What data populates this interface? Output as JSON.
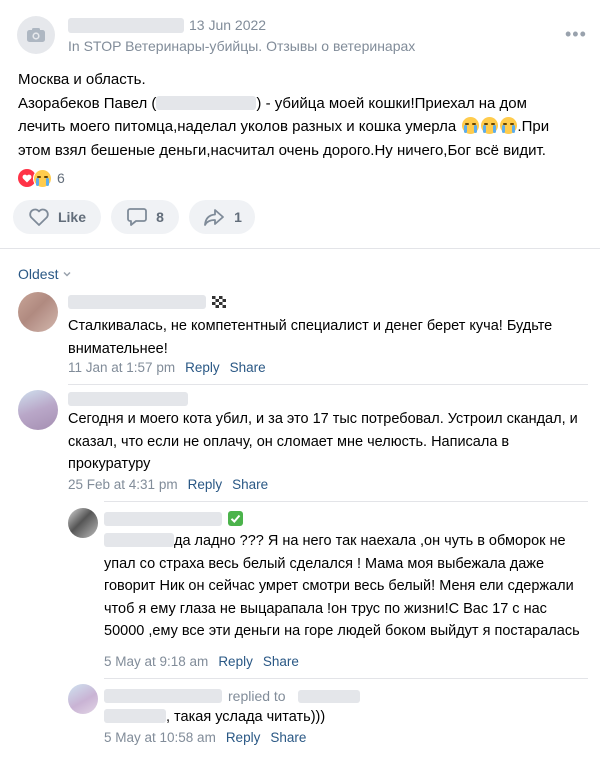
{
  "post": {
    "date": "13 Jun 2022",
    "group_prefix": "In",
    "group_name": "STOP Ветеринары-убийцы. Отзывы о ветеринарах",
    "text_line1": "Москва и область.",
    "text_name": "Азорабеков Павел",
    "text_after_name": ") - убийца моей кошки!Приехал на дом",
    "text_line3": "лечить моего питомца,наделал уколов разных и кошка умерла",
    "text_line3_end": ".При",
    "text_line4": "этом взял бешеные деньги,насчитал очень дорого.Ну ничего,Бог всё видит.",
    "reaction_count": "6",
    "like_label": "Like",
    "comments_count": "8",
    "shares_count": "1"
  },
  "comments_section": {
    "sort_label": "Oldest"
  },
  "comments": [
    {
      "text": "Сталкивалась, не компетентный специалист и денег берет куча! Будьте внимательнее!",
      "date": "11 Jan at 1:57 pm",
      "reply": "Reply",
      "share": "Share"
    },
    {
      "text": "Сегодня и моего кота убил, и за это 17 тыс потребовал. Устроил скандал, и сказал, что если не оплачу, он сломает мне челюсть. Написала в прокуратуру",
      "date": "25 Feb at 4:31 pm",
      "reply": "Reply",
      "share": "Share"
    }
  ],
  "replies": [
    {
      "text_line1": "да ладно ??? Я на него так наехала ,он чуть в обморок не",
      "text_rest": "упал со страха весь белый сделался ! Мама моя выбежала даже говорит Ник он сейчас умрет смотри весь белый! Меня ели сдержали чтоб я ему глаза не выцарапала !он трус по жизни!С Вас 17 с нас 50000 ,ему все эти деньги на горе людей боком выйдут я постаралась",
      "date": "5 May at 9:18 am",
      "reply": "Reply",
      "share": "Share"
    },
    {
      "replied_to": "replied to",
      "text": ", такая услада читать)))",
      "date": "5 May at 10:58 am",
      "reply": "Reply",
      "share": "Share"
    }
  ],
  "colors": {
    "link": "#2a5885",
    "secondary": "#818c99",
    "pill_bg": "#f0f2f5",
    "verified": "#4bb34b"
  },
  "icons": [
    "camera-icon",
    "more-icon",
    "heart-icon",
    "cry-emoji-icon",
    "like-icon",
    "comment-icon",
    "share-icon",
    "chevron-down-icon",
    "checkered-flag-icon",
    "verified-check-icon"
  ]
}
